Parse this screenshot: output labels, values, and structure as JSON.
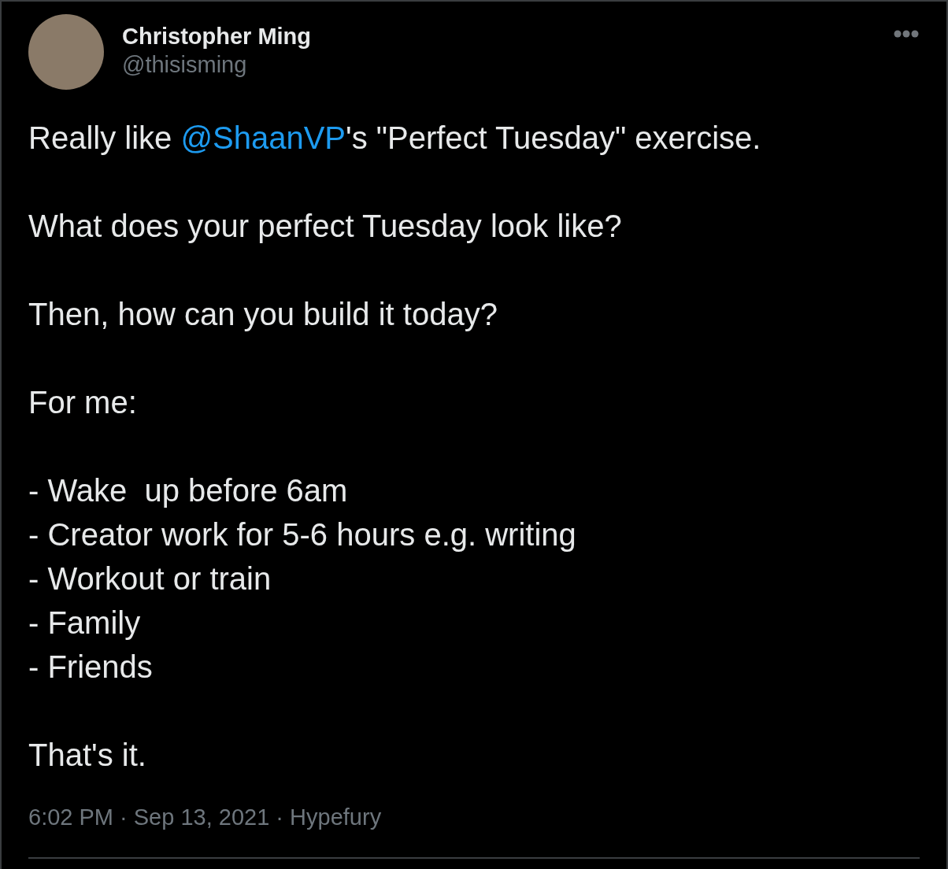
{
  "author": {
    "name": "Christopher Ming",
    "handle": "@thisisming"
  },
  "body": [
    {
      "lines": [
        {
          "before": "Really like ",
          "mention": "@ShaanVP",
          "after": "'s \"Perfect Tuesday\" exercise."
        }
      ]
    },
    {
      "lines": [
        {
          "text": "What does your perfect Tuesday look like?"
        }
      ]
    },
    {
      "lines": [
        {
          "text": "Then, how can you build it today?"
        }
      ]
    },
    {
      "lines": [
        {
          "text": "For me:"
        }
      ]
    },
    {
      "lines": [
        {
          "text": "- Wake  up before 6am"
        },
        {
          "text": "- Creator work for 5-6 hours e.g. writing"
        },
        {
          "text": "- Workout or train"
        },
        {
          "text": "- Family"
        },
        {
          "text": "- Friends"
        }
      ]
    },
    {
      "lines": [
        {
          "text": "That's it."
        }
      ]
    }
  ],
  "meta": "6:02 PM · Sep 13, 2021 · Hypefury"
}
